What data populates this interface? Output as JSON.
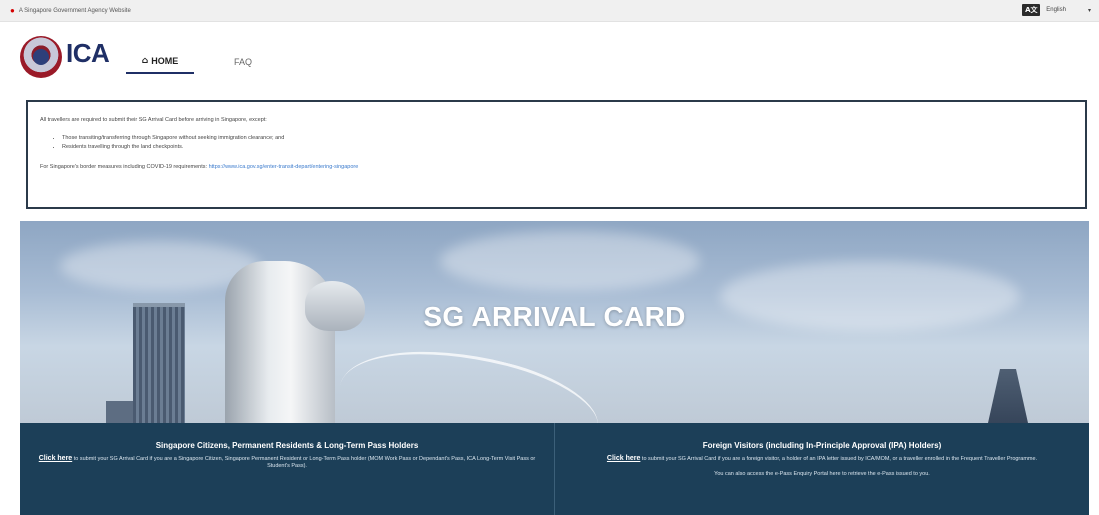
{
  "masthead": {
    "text": "A Singapore Government Agency Website",
    "language": "English"
  },
  "header": {
    "logo_text": "ICA",
    "nav": [
      {
        "label": "HOME",
        "active": true
      },
      {
        "label": "FAQ",
        "active": false
      }
    ]
  },
  "notice": {
    "intro": "All travellers are required to submit their SG Arrival Card before arriving in Singapore, except:",
    "items": [
      "Those transiting/transferring through Singapore without seeking immigration clearance; and",
      "Residents travelling through the land checkpoints."
    ],
    "footer_text": "For Singapore's border measures including COVID-19 requirements:",
    "footer_link": "https://www.ica.gov.sg/enter-transit-depart/entering-singapore"
  },
  "hero": {
    "title": "SG ARRIVAL CARD"
  },
  "panels": [
    {
      "heading": "Singapore Citizens, Permanent Residents & Long-Term Pass Holders",
      "link": "Click here",
      "text": "to submit your SG Arrival Card if you are a Singapore Citizen, Singapore Permanent Resident or Long-Term Pass holder (MOM Work Pass or Dependant's Pass, ICA Long-Term Visit Pass or Student's Pass).",
      "extra": ""
    },
    {
      "heading": "Foreign Visitors (including In-Principle Approval (IPA) Holders)",
      "link": "Click here",
      "text": "to submit your SG Arrival Card if you are a foreign visitor, a holder of an IPA letter issued by ICA/MOM, or a traveller enrolled in the Frequent Traveller Programme.",
      "extra": "You can also access the e-Pass Enquiry Portal here to retrieve the e-Pass issued to you."
    }
  ],
  "colors": {
    "brand_navy": "#1f2f66",
    "panel_bg": "#1c3f58",
    "notice_border": "#2b3a4a",
    "link": "#3a7acc"
  }
}
